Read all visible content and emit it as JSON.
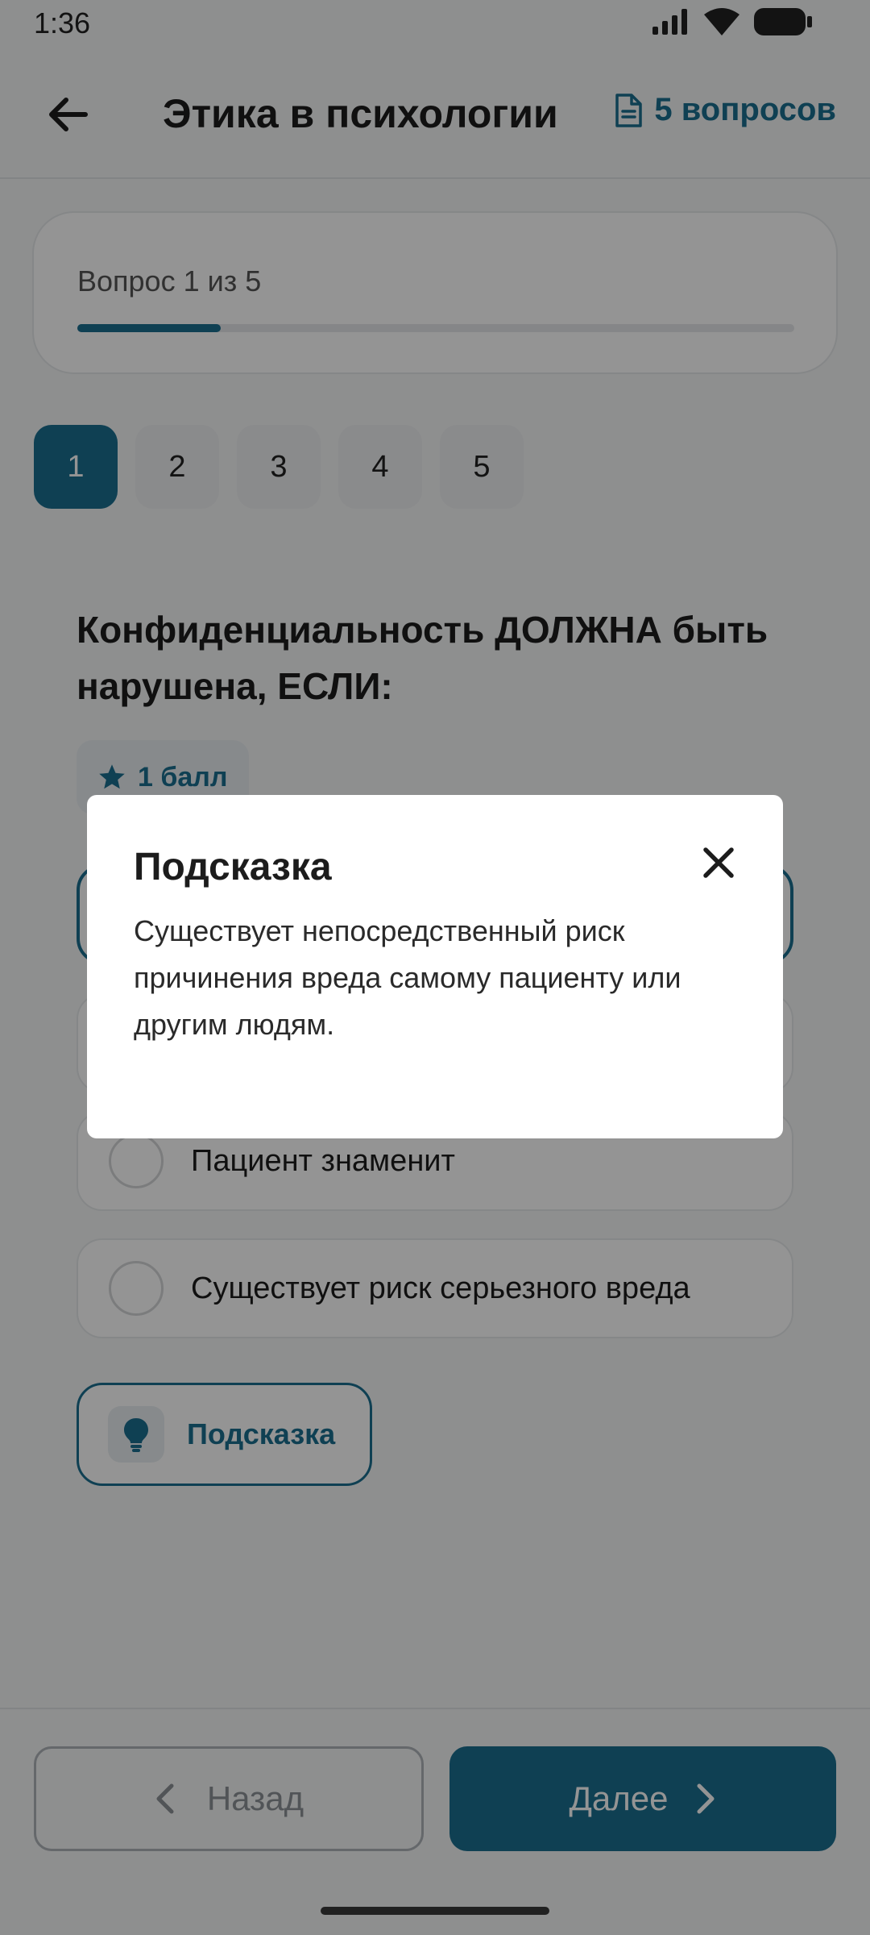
{
  "status_bar": {
    "time": "1:36"
  },
  "app_bar": {
    "title": "Этика в психологии",
    "question_count": "5 вопросов",
    "icons": {
      "back": "arrow-left-icon",
      "count": "document-icon"
    }
  },
  "progress": {
    "label": "Вопрос 1 из 5",
    "fraction": 0.2
  },
  "question_nav": [
    {
      "label": "1",
      "active": true
    },
    {
      "label": "2",
      "active": false
    },
    {
      "label": "3",
      "active": false
    },
    {
      "label": "4",
      "active": false
    },
    {
      "label": "5",
      "active": false
    }
  ],
  "question": {
    "text": "Конфиденциальность ДОЛЖНА быть нарушена, ЕСЛИ:",
    "points": "1 балл",
    "options": [
      {
        "label": "Пациент знаменит"
      },
      {
        "label": "Существует риск серьезного вреда"
      }
    ]
  },
  "hint_button": {
    "label": "Подсказка"
  },
  "footer": {
    "prev_label": "Назад",
    "next_label": "Далее"
  },
  "dialog": {
    "title": "Подсказка",
    "body": "Существует непосредственный риск причинения вреда самому пациенту или другим людям."
  },
  "colors": {
    "accent": "#1b6e8f",
    "accent_light": "#e8eef2"
  }
}
